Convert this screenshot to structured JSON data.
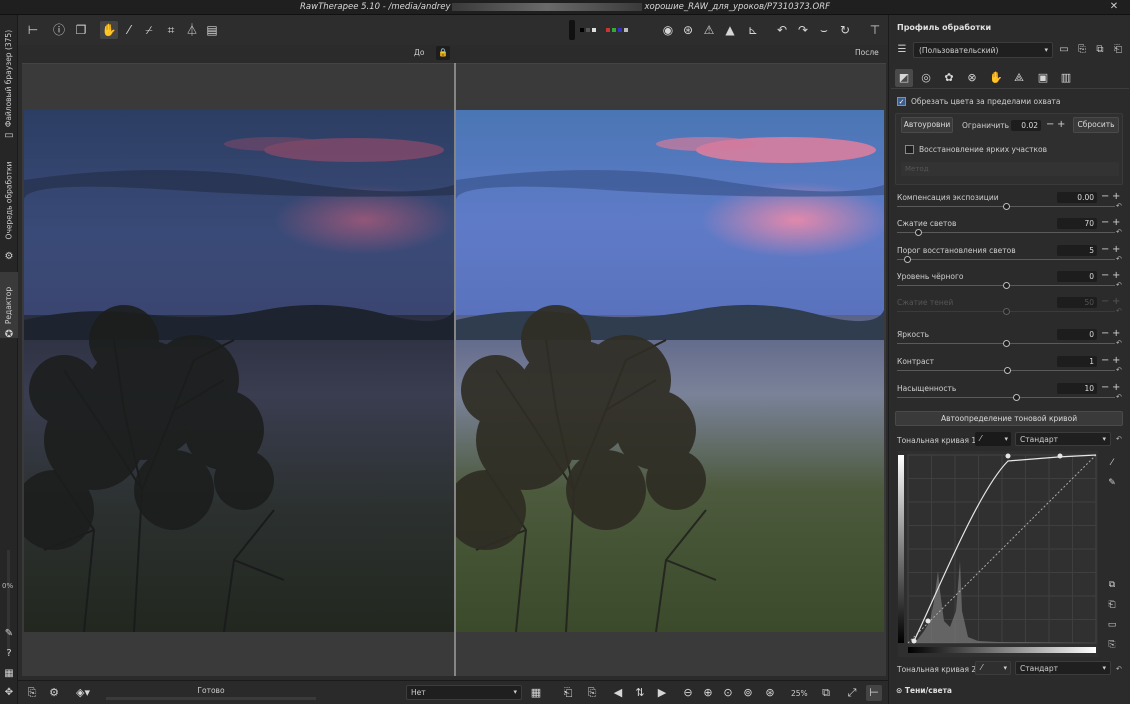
{
  "window": {
    "title": "RawTherapee 5.10 - /media/andrey",
    "title_path": "хорошие_RAW_для_уроков/P7310373.ORF",
    "close_glyph": "✕"
  },
  "left_tabs": {
    "file_browser": "Файловый браузер (375)",
    "queue": "Очередь обработки",
    "editor": "Редактор",
    "percent": "0%"
  },
  "toolbar": {
    "icons": [
      "tool-anchor-icon",
      "info-icon",
      "compare-icon",
      "hand-icon",
      "white-balance-picker-icon",
      "color-picker-icon",
      "crop-icon",
      "straighten-icon",
      "perspective-icon",
      "focus-icon",
      "overexposure-icon",
      "warning-icon",
      "underexposure-icon",
      "histogram-icon",
      "rotate-left-icon",
      "rotate-right-icon",
      "flip-vertical-icon",
      "flip-horizontal-icon",
      "pin-icon"
    ]
  },
  "preview": {
    "before_label": "До",
    "after_label": "После",
    "lock_glyph": "🔒"
  },
  "statusbar": {
    "progress_label": "Готово",
    "progress_fraction": 0,
    "dropdown_value": "Нет",
    "zoom": "25%"
  },
  "panel": {
    "title": "Профиль обработки",
    "profile_value": "(Пользовательский)",
    "clip_checkbox": "Обрезать цвета за пределами охвата",
    "auto_levels": "Автоуровни",
    "clip_limit_label": "Ограничить",
    "clip_limit_value": "0.02",
    "reset": "Сбросить",
    "highlight_recovery": "Восстановление ярких участков",
    "method_placeholder": "Метод",
    "sliders": [
      {
        "key": "exp",
        "label": "Компенсация экспозиции",
        "value": "0.00",
        "pos": 0.5,
        "dim": false
      },
      {
        "key": "hl",
        "label": "Сжатие светов",
        "value": "70",
        "pos": 0.1,
        "dim": false
      },
      {
        "key": "hlthr",
        "label": "Порог восстановления светов",
        "value": "5",
        "pos": 0.05,
        "dim": false
      },
      {
        "key": "black",
        "label": "Уровень чёрного",
        "value": "0",
        "pos": 0.5,
        "dim": false
      },
      {
        "key": "shcomp",
        "label": "Сжатие теней",
        "value": "50",
        "pos": 0.5,
        "dim": true
      },
      {
        "key": "bright",
        "label": "Яркость",
        "value": "0",
        "pos": 0.5,
        "dim": false
      },
      {
        "key": "contrast",
        "label": "Контраст",
        "value": "1",
        "pos": 0.505,
        "dim": false
      },
      {
        "key": "sat",
        "label": "Насыщенность",
        "value": "10",
        "pos": 0.55,
        "dim": false
      }
    ],
    "auto_tone_curve": "Автоопределение тоновой кривой",
    "tone_curve_1_label": "Тональная кривая 1:",
    "tone_curve_1_mode": "Стандарт",
    "tone_curve_2_label": "Тональная кривая 2:",
    "tone_curve_2_mode": "Стандарт",
    "next_section": "Тени/света"
  },
  "colors": {
    "accent": "#3b5d8f",
    "panel_bg": "#2b2b2b",
    "dark_bg": "#1f1f1f"
  }
}
